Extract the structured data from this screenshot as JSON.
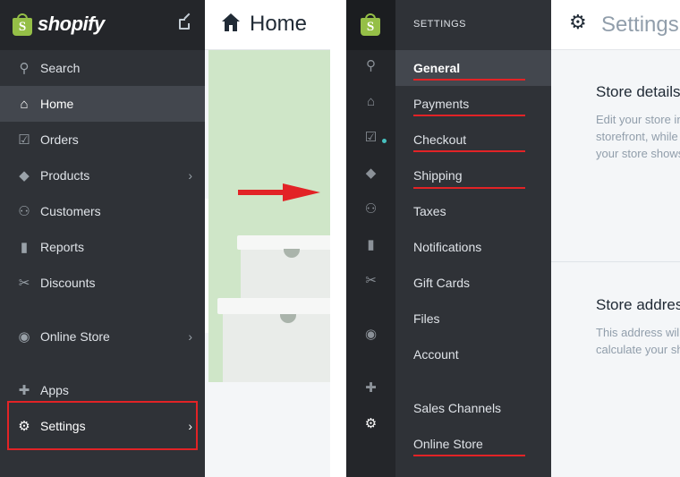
{
  "brand": {
    "name": "shopify",
    "bag_letter": "S",
    "accent": "#95bf47",
    "highlight": "#e22326"
  },
  "sidebar": {
    "items": [
      {
        "label": "Search",
        "icon": "search-icon",
        "glyph": "⚲"
      },
      {
        "label": "Home",
        "icon": "home-icon",
        "glyph": "⌂"
      },
      {
        "label": "Orders",
        "icon": "orders-icon",
        "glyph": "☑"
      },
      {
        "label": "Products",
        "icon": "tag-icon",
        "glyph": "◆"
      },
      {
        "label": "Customers",
        "icon": "customers-icon",
        "glyph": "⚇"
      },
      {
        "label": "Reports",
        "icon": "reports-icon",
        "glyph": "▮"
      },
      {
        "label": "Discounts",
        "icon": "discounts-icon",
        "glyph": "✂"
      },
      {
        "label": "Online Store",
        "icon": "globe-icon",
        "glyph": "◉"
      },
      {
        "label": "Apps",
        "icon": "puzzle-icon",
        "glyph": "✚"
      },
      {
        "label": "Settings",
        "icon": "gear-icon",
        "glyph": "⚙"
      }
    ],
    "chevron": "›"
  },
  "home": {
    "title": "Home"
  },
  "settings_menu": {
    "heading": "SETTINGS",
    "items": [
      "General",
      "Payments",
      "Checkout",
      "Shipping",
      "Taxes",
      "Notifications",
      "Gift Cards",
      "Files",
      "Account",
      "Sales Channels",
      "Online Store"
    ]
  },
  "settings_page": {
    "title": "Settings",
    "store_details": {
      "title": "Store details",
      "lines": [
        "Edit your store in",
        "storefront, while",
        "your store shows"
      ]
    },
    "store_address": {
      "title": "Store address",
      "lines": [
        "This address will",
        "calculate your sh"
      ]
    }
  }
}
